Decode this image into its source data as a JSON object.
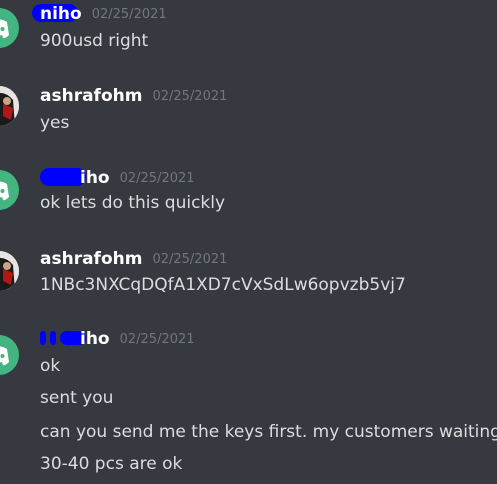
{
  "messages": [
    {
      "username": "niho",
      "timestamp": "02/25/2021",
      "avatar": "discord-default-green",
      "lines": [
        "900usd right"
      ]
    },
    {
      "username": "ashrafohm",
      "timestamp": "02/25/2021",
      "avatar": "user-photo",
      "lines": [
        "yes"
      ]
    },
    {
      "username": "iho",
      "timestamp": "02/25/2021",
      "avatar": "discord-default-green",
      "lines": [
        "ok lets do this quickly"
      ]
    },
    {
      "username": "ashrafohm",
      "timestamp": "02/25/2021",
      "avatar": "user-photo",
      "lines": [
        "1NBc3NXCqDQfA1XD7cVxSdLw6opvzb5vj7"
      ]
    },
    {
      "username": "iho",
      "timestamp": "02/25/2021",
      "avatar": "discord-default-green",
      "lines": [
        "ok",
        "sent you",
        "can you send me the keys first. my customers waiting.",
        "30-40 pcs are ok"
      ]
    }
  ],
  "colors": {
    "background": "#36393f",
    "username": "#ffffff",
    "timestamp": "#72767d",
    "text": "#dcddde",
    "default_avatar": "#43b581",
    "redaction": "#0000ff"
  }
}
